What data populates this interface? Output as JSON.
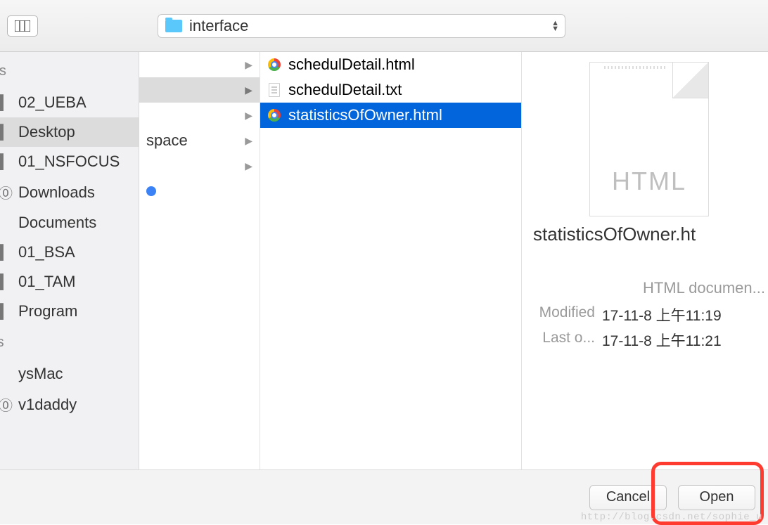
{
  "toolbar": {
    "path": "interface"
  },
  "sidebar": {
    "favorites_label": "orites",
    "favorites": [
      {
        "name": "02_UEBA"
      },
      {
        "name": "Desktop",
        "selected": true
      },
      {
        "name": "01_NSFOCUS"
      },
      {
        "name": "Downloads"
      },
      {
        "name": "Documents"
      },
      {
        "name": "01_BSA"
      },
      {
        "name": "01_TAM"
      },
      {
        "name": "Program"
      }
    ],
    "devices_label": "vices",
    "devices": [
      {
        "name": "ysMac"
      },
      {
        "name": "v1daddy"
      }
    ]
  },
  "column1": {
    "items": [
      {
        "name": "",
        "selected": true
      },
      {
        "name": "",
        "selected": false
      },
      {
        "name": "",
        "selected": false
      },
      {
        "name": "space",
        "selected": false
      },
      {
        "name": "",
        "selected": false
      }
    ]
  },
  "files": [
    {
      "name": "schedulDetail.html",
      "icon": "chrome",
      "selected": false
    },
    {
      "name": "schedulDetail.txt",
      "icon": "txt",
      "selected": false
    },
    {
      "name": "statisticsOfOwner.html",
      "icon": "chrome",
      "selected": true
    }
  ],
  "preview": {
    "ext_label": "HTML",
    "filename": "statisticsOfOwner.ht",
    "kind": "HTML documen...",
    "modified_label": "Modified",
    "modified_value": "17-11-8 上午11:19",
    "opened_label": "Last o...",
    "opened_value": "17-11-8 上午11:21"
  },
  "footer": {
    "cancel": "Cancel",
    "open": "Open",
    "watermark": "http://blog.csdn.net/sophie_u"
  }
}
